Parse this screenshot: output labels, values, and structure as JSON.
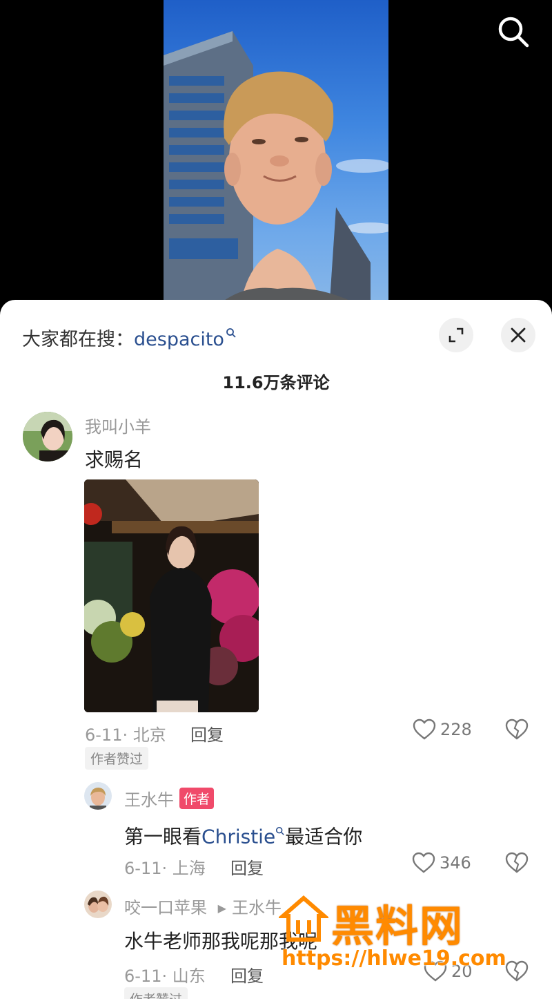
{
  "video": {
    "search_icon": "search-icon"
  },
  "header": {
    "hot_search_prefix": "大家都在搜：",
    "hot_search_keyword": "despacito",
    "expand_icon": "expand-icon",
    "close_icon": "close-icon"
  },
  "comment_count": "11.6万条评论",
  "comments": [
    {
      "username": "我叫小羊",
      "text": "求赐名",
      "date": "6-11",
      "location": "北京",
      "reply_label": "回复",
      "likes": "228",
      "tag": "作者赞过"
    },
    {
      "username": "王水牛",
      "badge": "作者",
      "text_prefix": "第一眼看",
      "text_link": "Christie",
      "text_suffix": "最适合你",
      "date": "6-11",
      "location": "上海",
      "reply_label": "回复",
      "likes": "346"
    },
    {
      "username": "咬一口苹果",
      "reply_to": "王水牛",
      "text": "水牛老师那我呢那我呢",
      "date": "6-11",
      "location": "山东",
      "reply_label": "回复",
      "likes": "20",
      "tag": "作者赞过"
    }
  ],
  "watermark": {
    "title": "黑料网",
    "url": "https://hlwe19.com"
  },
  "colors": {
    "link": "#2a4f8f",
    "author_badge": "#f04a6a",
    "watermark": "#ff8a00"
  }
}
